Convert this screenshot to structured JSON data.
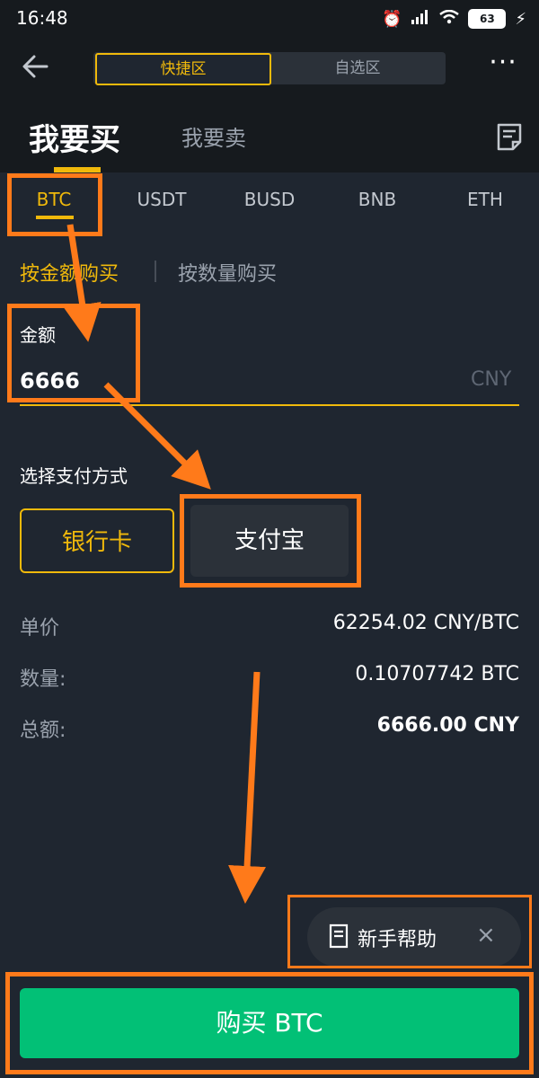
{
  "status_bar": {
    "time": "16:48",
    "battery": "63"
  },
  "header": {
    "segments": [
      "快捷区",
      "自选区"
    ],
    "more": "···",
    "buy_tab": "我要买",
    "sell_tab": "我要卖"
  },
  "coins": [
    "BTC",
    "USDT",
    "BUSD",
    "BNB",
    "ETH"
  ],
  "mode": {
    "by_amount": "按金额购买",
    "by_quantity": "按数量购买"
  },
  "amount": {
    "label": "金额",
    "value": "6666",
    "unit": "CNY"
  },
  "payment": {
    "label": "选择支付方式",
    "options": [
      "银行卡",
      "支付宝"
    ]
  },
  "summary": {
    "price_label": "单价",
    "price_value": "62254.02 CNY/BTC",
    "qty_label": "数量:",
    "qty_value": "0.10707742 BTC",
    "total_label": "总额:",
    "total_value": "6666.00 CNY"
  },
  "help": {
    "label": "新手帮助",
    "close": "×"
  },
  "buy_button": "购买 BTC",
  "colors": {
    "accent": "#f0b90b",
    "buy_green": "#02c076",
    "highlight": "#ff7a1a"
  },
  "icons": [
    "back-arrow-icon",
    "more-icon",
    "order-doc-icon",
    "help-doc-icon",
    "close-icon",
    "alarm-icon",
    "signal-icon",
    "wifi-icon",
    "battery-icon",
    "charging-icon"
  ]
}
